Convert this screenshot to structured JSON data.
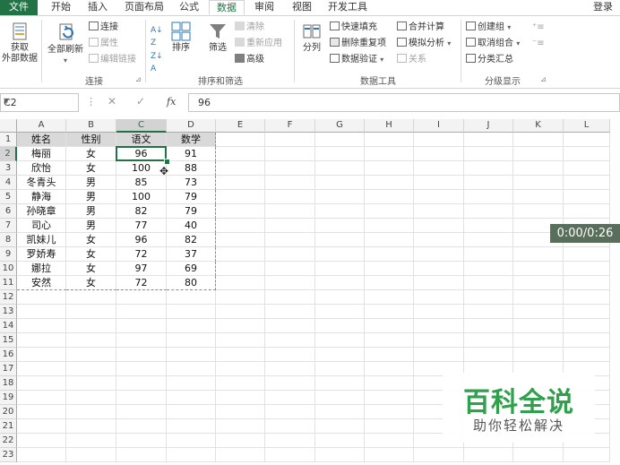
{
  "tabs": [
    "文件",
    "开始",
    "插入",
    "页面布局",
    "公式",
    "数据",
    "审阅",
    "视图",
    "开发工具"
  ],
  "active_tab": "数据",
  "login": "登录",
  "ribbon": {
    "get_external": "获取\n外部数据",
    "connections": {
      "refresh_all": "全部刷新",
      "connect": "连接",
      "properties": "属性",
      "edit_links": "编辑链接",
      "label": "连接"
    },
    "sort_filter": {
      "sort": "排序",
      "filter": "筛选",
      "clear": "清除",
      "reapply": "重新应用",
      "advanced": "高级",
      "label": "排序和筛选"
    },
    "data_tools": {
      "text_to_columns": "分列",
      "flash_fill": "快速填充",
      "remove_duplicates": "删除重复项",
      "data_validation": "数据验证",
      "consolidate": "合并计算",
      "what_if": "模拟分析",
      "relationships": "关系",
      "label": "数据工具"
    },
    "outline": {
      "group": "创建组",
      "ungroup": "取消组合",
      "subtotal": "分类汇总",
      "label": "分级显示"
    }
  },
  "formula_bar": {
    "name_box": "C2",
    "value": "96"
  },
  "columns": [
    "A",
    "B",
    "C",
    "D",
    "E",
    "F",
    "G",
    "H",
    "I",
    "J",
    "K",
    "L"
  ],
  "selected_column": "C",
  "rows": [
    "1",
    "2",
    "3",
    "4",
    "5",
    "6",
    "7",
    "8",
    "9",
    "10",
    "11",
    "12",
    "13",
    "14",
    "15",
    "16",
    "17",
    "18",
    "19",
    "20",
    "21",
    "22",
    "23"
  ],
  "selected_row": "2",
  "table": {
    "headers": [
      "姓名",
      "性别",
      "语文",
      "数学"
    ],
    "data": [
      [
        "梅丽",
        "女",
        "96",
        "91"
      ],
      [
        "欣怡",
        "女",
        "100",
        "88"
      ],
      [
        "冬青头",
        "男",
        "85",
        "73"
      ],
      [
        "静海",
        "男",
        "100",
        "79"
      ],
      [
        "孙晓章",
        "男",
        "82",
        "79"
      ],
      [
        "司心",
        "男",
        "77",
        "40"
      ],
      [
        "凯妹儿",
        "女",
        "96",
        "82"
      ],
      [
        "罗娇寿",
        "女",
        "72",
        "37"
      ],
      [
        "娜拉",
        "女",
        "97",
        "69"
      ],
      [
        "安然",
        "女",
        "72",
        "80"
      ]
    ]
  },
  "video_time": "0:00/0:26",
  "watermark": {
    "title": "百科全说",
    "subtitle": "助你轻松解决"
  },
  "colors": {
    "excel_green": "#217346",
    "watermark_green": "#2fa04c"
  }
}
